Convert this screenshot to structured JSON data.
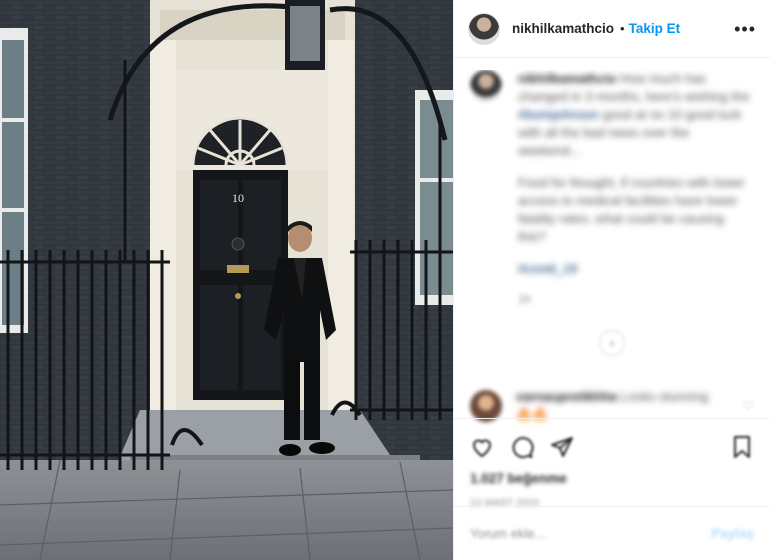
{
  "post": {
    "username": "nikhilkamathcio",
    "follow_label": "Takip Et",
    "separator": "•",
    "more_label": "•••",
    "door_number": "10"
  },
  "comments": {
    "caption_user": "nikhilkamathcio",
    "caption_p1": "How much has changed in 3 months, here's wishing the",
    "caption_tag": "#borisjohnson",
    "caption_p1b": "good at no 10 good luck with all the bad news over the weekend...",
    "caption_p2": "Food for thought, if countries with lower access to medical facilities have lower fatality rates, what could be causing this?",
    "caption_hashtag": "#covid_19",
    "caption_time": "1h",
    "load_more": "+",
    "reply_user": "varnaupretikhha",
    "reply_text": "Looks stunning",
    "reply_emoji": "🔥🔥"
  },
  "actions": {
    "likes": "1.027 beğenme",
    "date": "23 Mart 2020"
  },
  "add_comment": {
    "placeholder": "Yorum ekle...",
    "post_label": "Paylaş"
  }
}
